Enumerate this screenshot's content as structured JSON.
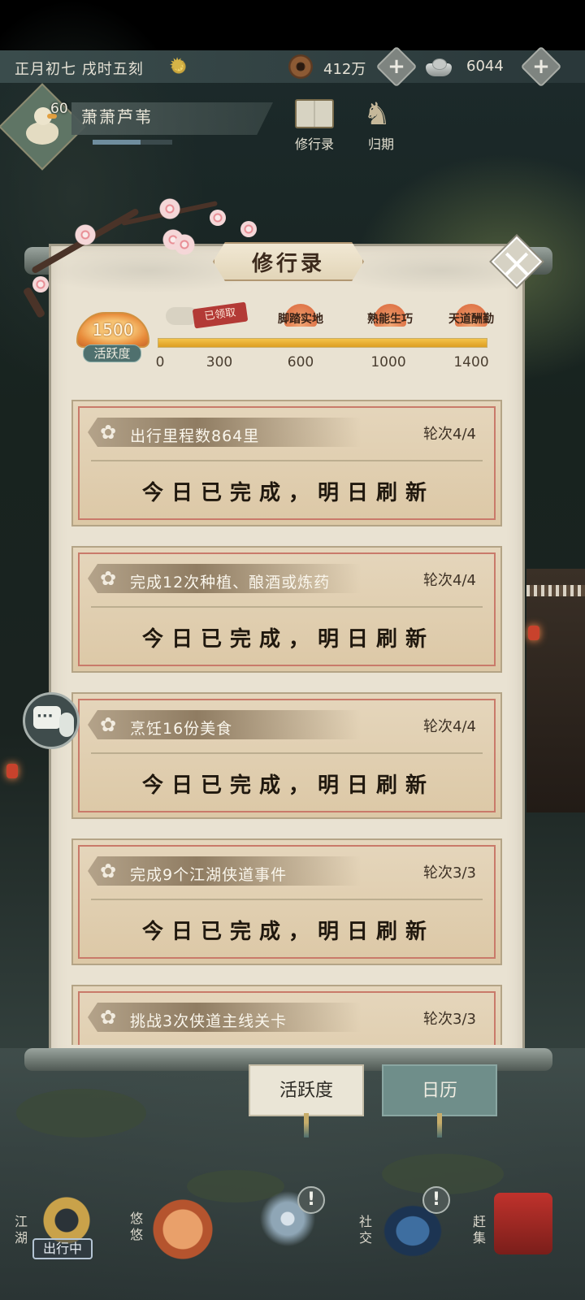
{
  "topbar": {
    "date": "正月初七  戌时五刻",
    "coins": "412万",
    "silver": "6044",
    "coin_plus": "+",
    "silver_plus": "+"
  },
  "player": {
    "level": "60",
    "name": "萧萧芦苇",
    "exp_fraction": 0.6
  },
  "quick": {
    "journal": "修行录",
    "return": "归期"
  },
  "panel": {
    "title": "修行录",
    "activity": {
      "value": "1500",
      "label": "活跃度",
      "progress_fraction": 1.0,
      "ticks": [
        "0",
        "300",
        "600",
        "1000",
        "1400"
      ],
      "claimed_label": "已领取",
      "rewards": [
        "脚踏实地",
        "熟能生巧",
        "天道酬勤"
      ]
    },
    "tasks": [
      {
        "name": "出行里程数864里",
        "round": "轮次4/4",
        "status": "今日已完成，明日刷新"
      },
      {
        "name": "完成12次种植、酿酒或炼药",
        "round": "轮次4/4",
        "status": "今日已完成，明日刷新"
      },
      {
        "name": "烹饪16份美食",
        "round": "轮次4/4",
        "status": "今日已完成，明日刷新"
      },
      {
        "name": "完成9个江湖侠道事件",
        "round": "轮次3/3",
        "status": "今日已完成，明日刷新"
      },
      {
        "name": "挑战3次侠道主线关卡",
        "round": "轮次3/3",
        "status": ""
      }
    ]
  },
  "tabs": {
    "activity": "活跃度",
    "calendar": "日历"
  },
  "nav": {
    "jianghu": "江湖",
    "travel_status": "出行中",
    "youyou": "悠悠",
    "social": "社交",
    "market": "赶集",
    "alert_mark": "!"
  },
  "colors": {
    "accent_gold": "#dd9e22",
    "claimed_red": "#b33a36",
    "tab_teal": "#6f8e8a"
  }
}
